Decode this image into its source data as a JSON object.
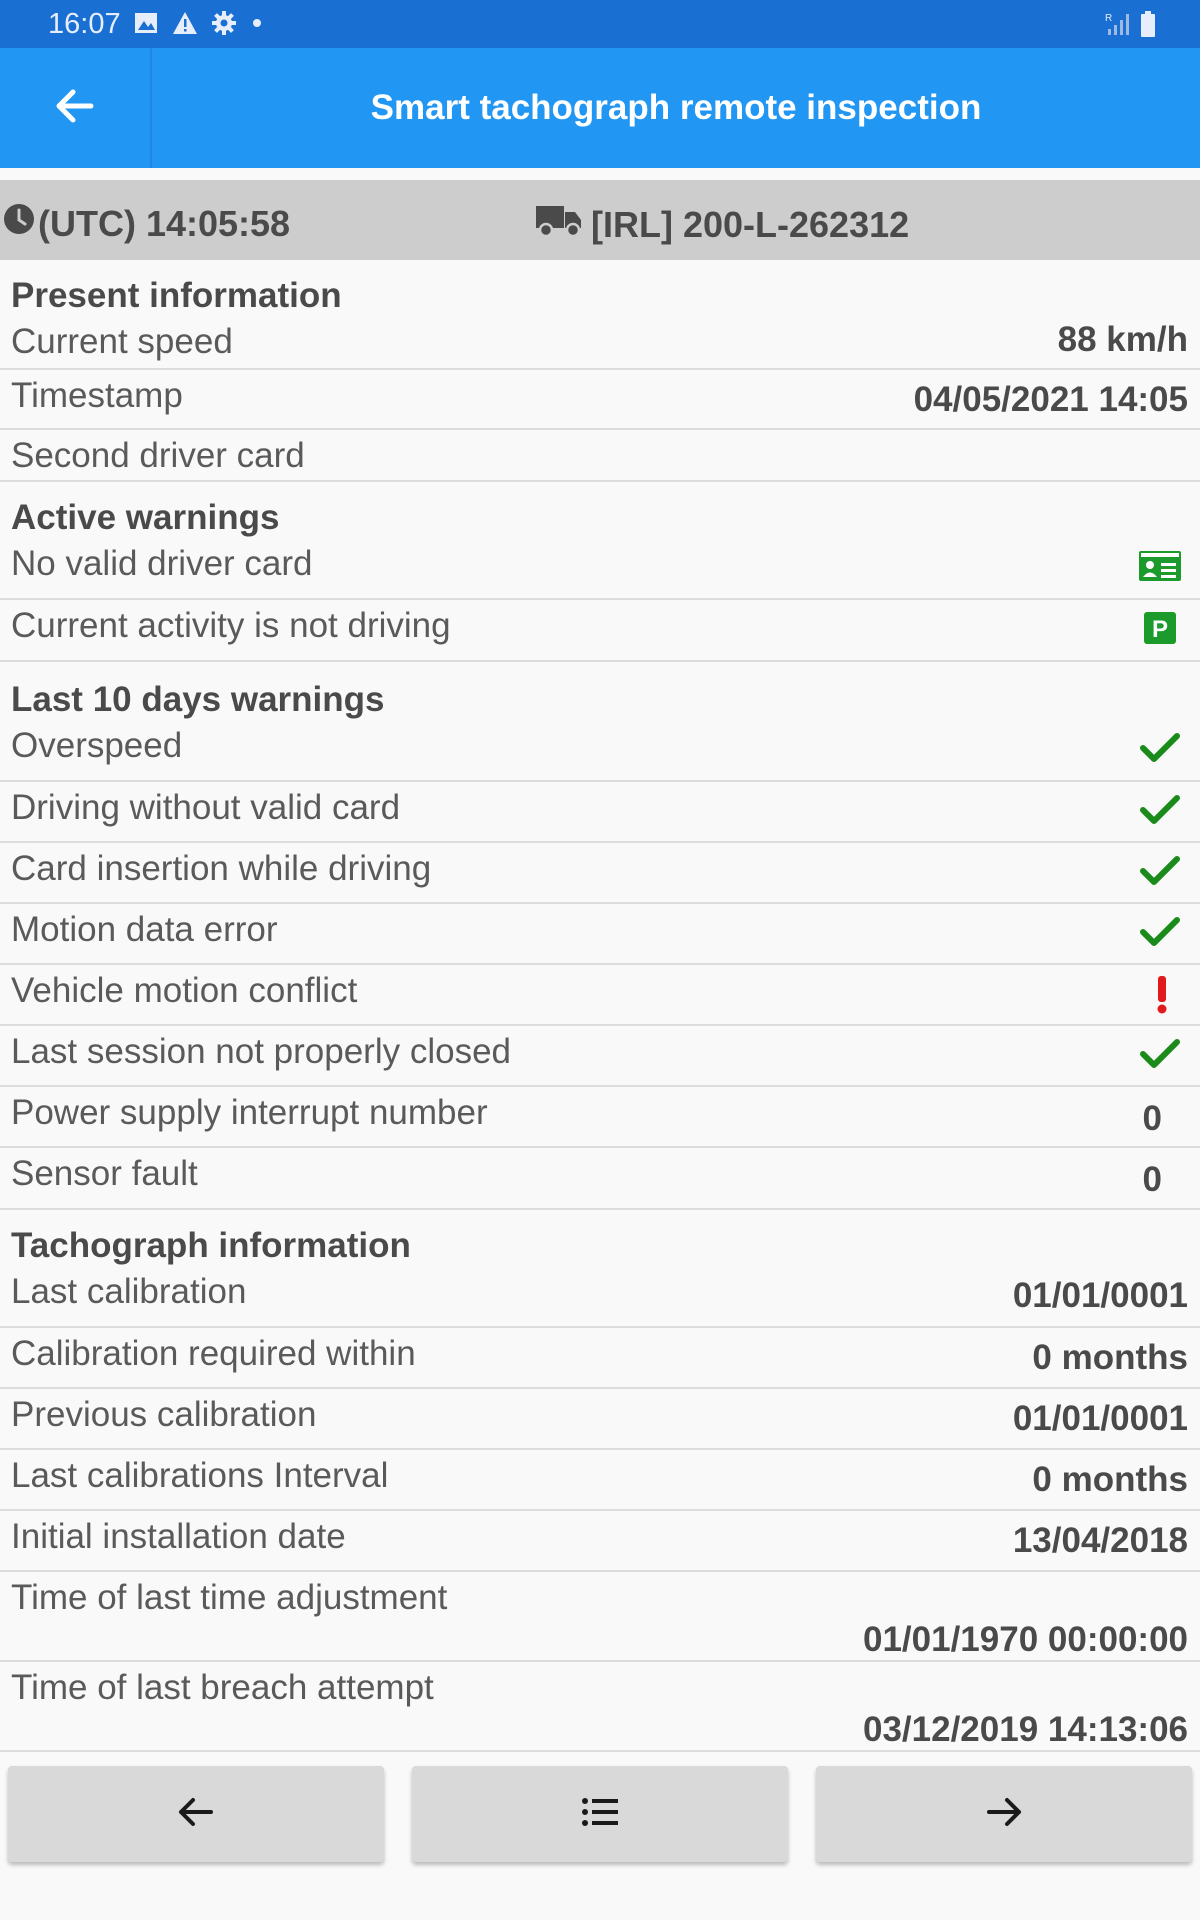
{
  "status_bar": {
    "time": "16:07",
    "left_icons": [
      "image-icon",
      "warning-icon",
      "settings-icon",
      "dot-icon"
    ],
    "right_icons": [
      "signal-roaming-icon",
      "battery-icon"
    ]
  },
  "app_bar": {
    "title": "Smart tachograph remote inspection",
    "back_icon": "arrow-left-icon"
  },
  "info_bar": {
    "clock_icon": "clock-icon",
    "time": "(UTC) 14:05:58",
    "vehicle_icon": "truck-icon",
    "vehicle": "[IRL] 200-L-262312"
  },
  "present_information": {
    "title": "Present information",
    "current_speed": {
      "label": "Current speed",
      "value": "88 km/h"
    },
    "timestamp": {
      "label": "Timestamp",
      "value": "04/05/2021 14:05"
    },
    "second_driver_card": {
      "label": "Second driver card",
      "value": ""
    }
  },
  "active_warnings": {
    "title": "Active warnings",
    "no_valid_driver_card": {
      "label": "No valid driver card",
      "icon": "driver-card-icon"
    },
    "not_driving": {
      "label": "Current activity is not driving",
      "icon": "parking-icon"
    }
  },
  "last_10_days": {
    "title": "Last 10 days warnings",
    "overspeed": {
      "label": "Overspeed",
      "status": "ok"
    },
    "driving_without_card": {
      "label": "Driving without valid card",
      "status": "ok"
    },
    "card_insertion": {
      "label": "Card insertion while driving",
      "status": "ok"
    },
    "motion_data_error": {
      "label": "Motion data error",
      "status": "ok"
    },
    "vehicle_motion_conflict": {
      "label": "Vehicle motion conflict",
      "status": "alert"
    },
    "last_session": {
      "label": "Last session not properly closed",
      "status": "ok"
    },
    "power_supply": {
      "label": "Power supply interrupt number",
      "value": "0"
    },
    "sensor_fault": {
      "label": "Sensor fault",
      "value": "0"
    }
  },
  "tachograph_information": {
    "title": "Tachograph information",
    "last_calibration": {
      "label": "Last calibration",
      "value": "01/01/0001"
    },
    "calibration_required": {
      "label": "Calibration required within",
      "value": "0 months"
    },
    "previous_calibration": {
      "label": "Previous calibration",
      "value": "01/01/0001"
    },
    "calibrations_interval": {
      "label": "Last calibrations Interval",
      "value": "0 months"
    },
    "installation_date": {
      "label": "Initial installation date",
      "value": "13/04/2018"
    },
    "last_time_adjustment": {
      "label": "Time of last time adjustment",
      "value": "01/01/1970 00:00:00"
    },
    "last_breach_attempt": {
      "label": "Time of last breach attempt",
      "value": "03/12/2019 14:13:06"
    }
  },
  "bottom_nav": {
    "prev_icon": "arrow-left-icon",
    "list_icon": "list-icon",
    "next_icon": "arrow-right-icon"
  },
  "colors": {
    "app_bar": "#2196f3",
    "status_bar": "#1a6fd3",
    "ok_green": "#1a8a1a",
    "alert_red": "#e11b1b",
    "icon_green": "#1d9a2c"
  }
}
